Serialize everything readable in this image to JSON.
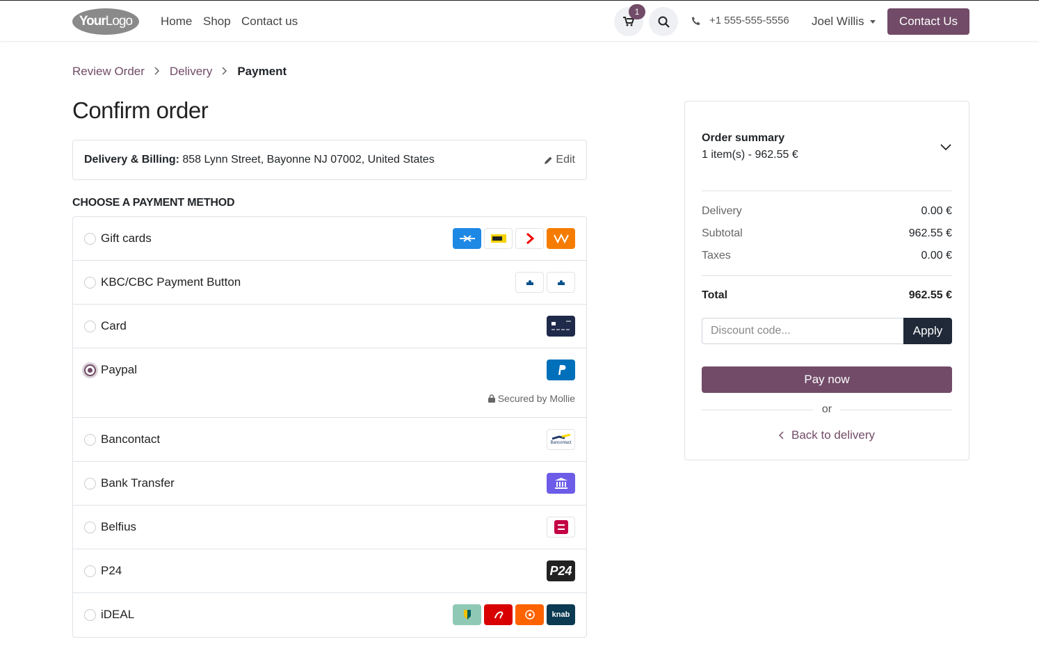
{
  "header": {
    "logo_bold": "Your",
    "logo_light": "Logo",
    "nav": [
      "Home",
      "Shop",
      "Contact us"
    ],
    "cart_count": "1",
    "phone": "+1 555-555-5556",
    "user": "Joel Willis",
    "contact_button": "Contact Us"
  },
  "breadcrumb": [
    "Review Order",
    "Delivery",
    "Payment"
  ],
  "page_title": "Confirm order",
  "address": {
    "label": "Delivery & Billing:",
    "value": "858 Lynn Street, Bayonne NJ 07002, United States",
    "edit": "Edit"
  },
  "payment_section_title": "CHOOSE A PAYMENT METHOD",
  "payment_methods": [
    {
      "label": "Gift cards",
      "selected": false
    },
    {
      "label": "KBC/CBC Payment Button",
      "selected": false
    },
    {
      "label": "Card",
      "selected": false
    },
    {
      "label": "Paypal",
      "selected": true,
      "note": "Secured by Mollie"
    },
    {
      "label": "Bancontact",
      "selected": false,
      "logo_text": "Bancontact"
    },
    {
      "label": "Bank Transfer",
      "selected": false
    },
    {
      "label": "Belfius",
      "selected": false
    },
    {
      "label": "P24",
      "selected": false,
      "logo_text": "P24"
    },
    {
      "label": "iDEAL",
      "selected": false,
      "logo_text": "knab"
    }
  ],
  "summary": {
    "title": "Order summary",
    "items": "1 item(s) -  962.55 €",
    "rows": [
      {
        "label": "Delivery",
        "value": "0.00 €"
      },
      {
        "label": "Subtotal",
        "value": "962.55 €"
      },
      {
        "label": "Taxes",
        "value": "0.00 €"
      }
    ],
    "total_label": "Total",
    "total_value": "962.55 €",
    "discount_placeholder": "Discount code...",
    "apply": "Apply",
    "pay_now": "Pay now",
    "or": "or",
    "back": "Back to delivery"
  },
  "colors": {
    "brand": "#714b67",
    "dark_button": "#1f2937"
  }
}
